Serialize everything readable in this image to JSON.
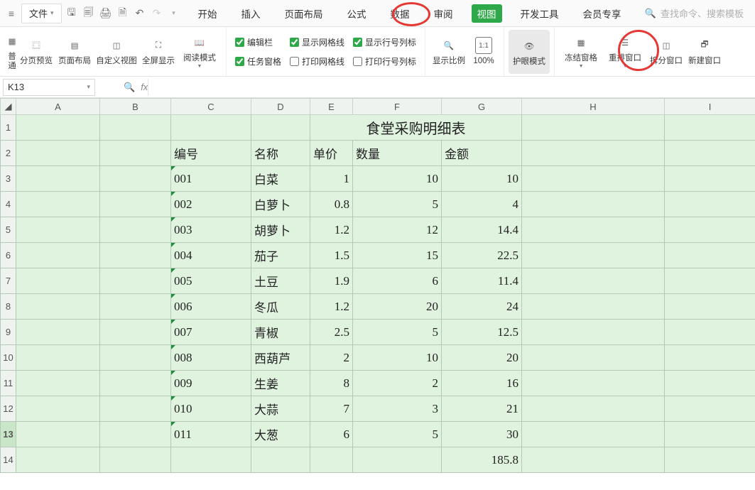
{
  "quick_access": {
    "file_label": "文件",
    "search_placeholder": "查找命令、搜索模板"
  },
  "menu_tabs": {
    "items": [
      {
        "label": "开始"
      },
      {
        "label": "插入"
      },
      {
        "label": "页面布局"
      },
      {
        "label": "公式"
      },
      {
        "label": "数据"
      },
      {
        "label": "审阅"
      },
      {
        "label": "视图"
      },
      {
        "label": "开发工具"
      },
      {
        "label": "会员专享"
      }
    ],
    "active_index": 6
  },
  "ribbon": {
    "view_modes": {
      "normal": "普通",
      "page_break": "分页预览",
      "page_layout": "页面布局",
      "custom_view": "自定义视图",
      "fullscreen": "全屏显示",
      "read_mode": "阅读模式"
    },
    "check_left": {
      "formula_bar": {
        "label": "编辑栏",
        "checked": true
      },
      "task_pane": {
        "label": "任务窗格",
        "checked": true
      }
    },
    "check_mid": {
      "show_grid": {
        "label": "显示网格线",
        "checked": true
      },
      "print_grid": {
        "label": "打印网格线",
        "checked": false
      }
    },
    "check_right": {
      "show_rowcol": {
        "label": "显示行号列标",
        "checked": true
      },
      "print_rowcol": {
        "label": "打印行号列标",
        "checked": false
      }
    },
    "zoom": {
      "label": "显示比例",
      "value": "100%",
      "one_to_one": "1:1"
    },
    "eye_care": "护眼模式",
    "freeze": "冻结窗格",
    "rearrange": "重排窗口",
    "split": "拆分窗口",
    "new_window": "新建窗口"
  },
  "formula_bar": {
    "name_box": "K13",
    "fx_value": ""
  },
  "grid": {
    "columns": [
      "A",
      "B",
      "C",
      "D",
      "E",
      "F",
      "G",
      "H",
      "I"
    ],
    "selected_row": 13,
    "title_row": {
      "text": "食堂采购明细表",
      "across_cols": "E:G"
    },
    "headers_row": {
      "C": "编号",
      "D": "名称",
      "E": "单价",
      "F": "数量",
      "G": "金额"
    },
    "rows": [
      {
        "id": "001",
        "name": "白菜",
        "price": 1,
        "qty": 10,
        "amount": 10
      },
      {
        "id": "002",
        "name": "白萝卜",
        "price": 0.8,
        "qty": 5,
        "amount": 4
      },
      {
        "id": "003",
        "name": "胡萝卜",
        "price": 1.2,
        "qty": 12,
        "amount": 14.4
      },
      {
        "id": "004",
        "name": "茄子",
        "price": 1.5,
        "qty": 15,
        "amount": 22.5
      },
      {
        "id": "005",
        "name": "土豆",
        "price": 1.9,
        "qty": 6,
        "amount": 11.4
      },
      {
        "id": "006",
        "name": "冬瓜",
        "price": 1.2,
        "qty": 20,
        "amount": 24
      },
      {
        "id": "007",
        "name": "青椒",
        "price": 2.5,
        "qty": 5,
        "amount": 12.5
      },
      {
        "id": "008",
        "name": "西葫芦",
        "price": 2,
        "qty": 10,
        "amount": 20
      },
      {
        "id": "009",
        "name": "生姜",
        "price": 8,
        "qty": 2,
        "amount": 16
      },
      {
        "id": "010",
        "name": "大蒜",
        "price": 7,
        "qty": 3,
        "amount": 21
      },
      {
        "id": "011",
        "name": "大葱",
        "price": 6,
        "qty": 5,
        "amount": 30
      }
    ],
    "total_amount": 185.8
  }
}
